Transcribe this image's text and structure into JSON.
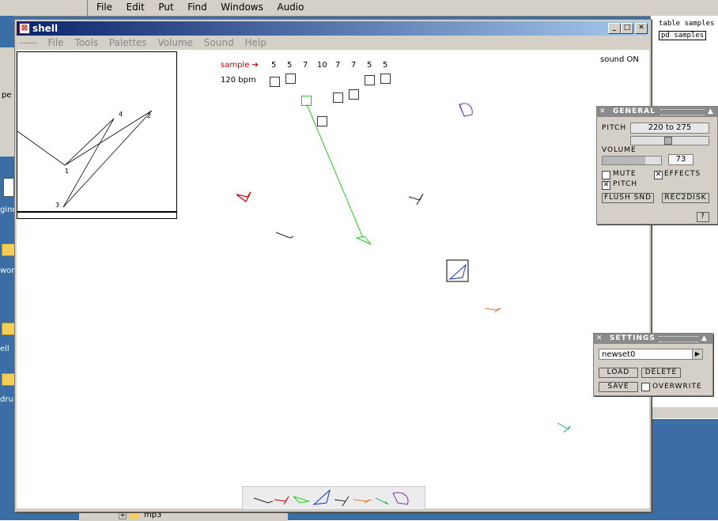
{
  "pd_menu": [
    "File",
    "Edit",
    "Put",
    "Find",
    "Windows",
    "Audio"
  ],
  "right_objects": {
    "item1": "table samples",
    "item2": "pd samples"
  },
  "left_strip": {
    "pe": "pe",
    "gine": "gine",
    "wor": "wor",
    "ell": "ell",
    "dru": "dru",
    "mp3": "mp3"
  },
  "shell": {
    "title": "shell",
    "menu": [
      "-----",
      "File",
      "Tools",
      "Palettes",
      "Volume",
      "Sound",
      "Help"
    ],
    "min_glyph": "_",
    "max_glyph": "□",
    "close_glyph": "✕"
  },
  "canvas": {
    "sample_label": "sample ➔",
    "sample_values": [
      "5",
      "5",
      "7",
      "10",
      "7",
      "7",
      "5",
      "5"
    ],
    "bpm": "120 bpm",
    "sound_status": "sound ON",
    "graph_labels": [
      "1",
      "4",
      "2",
      "3"
    ]
  },
  "general_panel": {
    "title": "GENERAL",
    "pitch_label": "PITCH",
    "pitch_value": "220 to 275",
    "volume_label": "VOLUME",
    "volume_value": "73",
    "volume_level": 0.73,
    "mute_label": "MUTE",
    "effects_label": "EFFECTS",
    "pitch_check_label": "PITCH",
    "flush_label": "FLUSH SND",
    "rec_label": "REC2DISK",
    "help_label": "?",
    "mute_checked": false,
    "effects_checked": true,
    "pitch_checked": true
  },
  "settings_panel": {
    "title": "SETTINGS",
    "preset": "newset0",
    "load_label": "LOAD",
    "delete_label": "DELETE",
    "save_label": "SAVE",
    "overwrite_label": "OVERWRITE",
    "overwrite_checked": false
  },
  "colors": {
    "accent_red": "#cc0000",
    "green": "#22cc22",
    "purple": "#7733aa",
    "blue": "#1133cc",
    "orange": "#e07a30",
    "teal": "#22bb66"
  }
}
